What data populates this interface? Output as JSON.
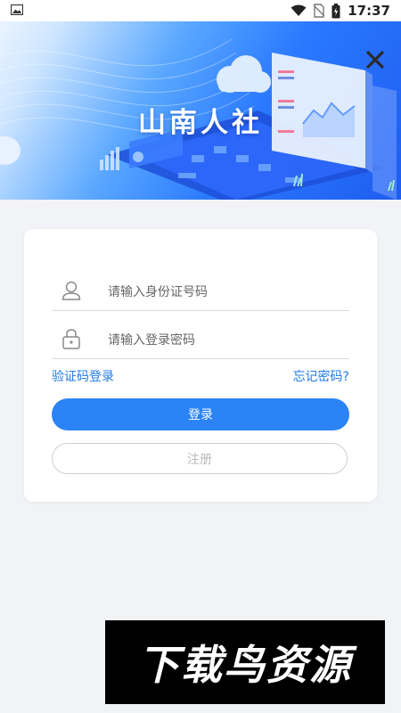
{
  "status_bar": {
    "time": "17:37"
  },
  "banner": {
    "title": "山南人社"
  },
  "login": {
    "id_placeholder": "请输入身份证号码",
    "password_placeholder": "请输入登录密码",
    "sms_login_label": "验证码登录",
    "forgot_password_label": "忘记密码?",
    "login_button": "登录",
    "register_button": "注册"
  },
  "watermark": {
    "text": "下载鸟资源"
  },
  "colors": {
    "primary": "#2b83f6",
    "link": "#1f7be6",
    "page_background": "#f2f3f6"
  },
  "icons": [
    "image-icon",
    "wifi-icon",
    "no-sim-icon",
    "battery-icon",
    "close-icon",
    "user-icon",
    "lock-icon"
  ]
}
